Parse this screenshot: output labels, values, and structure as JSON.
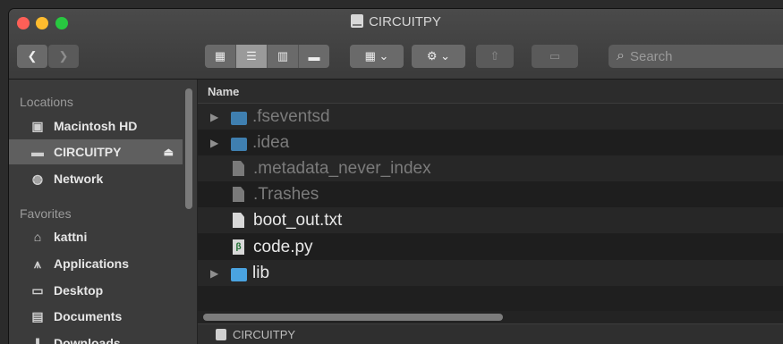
{
  "window": {
    "title": "CIRCUITPY"
  },
  "toolbar": {
    "back": "❮",
    "forward": "❯",
    "search_placeholder": "Search"
  },
  "sidebar": {
    "locations_header": "Locations",
    "locations": [
      {
        "label": "Macintosh HD",
        "icon": "hard-drive-icon"
      },
      {
        "label": "CIRCUITPY",
        "icon": "usb-drive-icon",
        "selected": true
      },
      {
        "label": "Network",
        "icon": "network-globe-icon"
      }
    ],
    "favorites_header": "Favorites",
    "favorites": [
      {
        "label": "kattni",
        "icon": "home-icon"
      },
      {
        "label": "Applications",
        "icon": "applications-icon"
      },
      {
        "label": "Desktop",
        "icon": "desktop-icon"
      },
      {
        "label": "Documents",
        "icon": "documents-icon"
      },
      {
        "label": "Downloads",
        "icon": "downloads-icon"
      }
    ]
  },
  "list": {
    "column_name": "Name",
    "files": [
      {
        "name": ".fseventsd",
        "type": "folder",
        "hidden": true
      },
      {
        "name": ".idea",
        "type": "folder",
        "hidden": true
      },
      {
        "name": ".metadata_never_index",
        "type": "file",
        "hidden": true
      },
      {
        "name": ".Trashes",
        "type": "file",
        "hidden": true
      },
      {
        "name": "boot_out.txt",
        "type": "file",
        "hidden": false
      },
      {
        "name": "code.py",
        "type": "python",
        "hidden": false
      },
      {
        "name": "lib",
        "type": "folder",
        "hidden": false
      }
    ]
  },
  "pathbar": {
    "label": "CIRCUITPY"
  }
}
